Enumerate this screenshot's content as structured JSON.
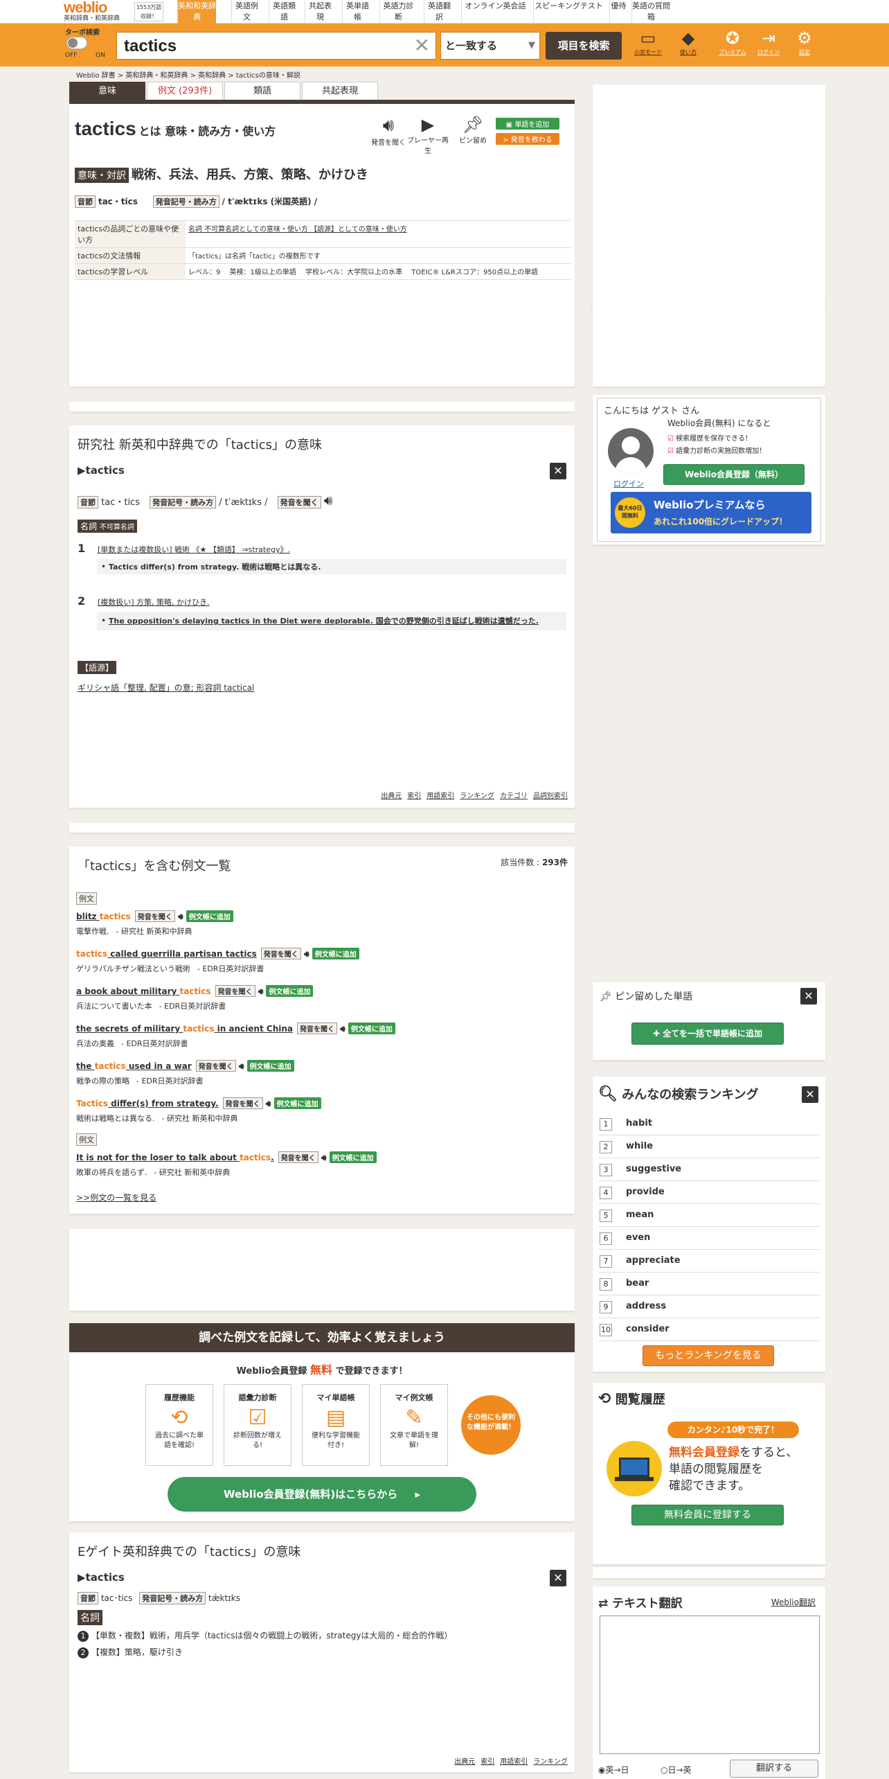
{
  "topnav": {
    "logo": "weblio",
    "logo_sub": "英和辞典・和英辞典",
    "word_count": "1553万語収録！",
    "tabs": [
      "英和和英辞典",
      "英語例文",
      "英語類語",
      "共起表現",
      "英単語帳",
      "英語力診断",
      "英語翻訳",
      "オンライン英会話",
      "スピーキングテスト",
      "優待",
      "英語の質問箱"
    ]
  },
  "searchbar": {
    "turbo_label": "ターボ検索",
    "turbo_off": "OFF",
    "turbo_on": "ON",
    "query": "tactics",
    "match_mode": "と一致する",
    "search_button": "項目を検索",
    "icons": [
      {
        "icon": "monitor-icon",
        "label": "小窓モード"
      },
      {
        "icon": "beginner-icon",
        "label": "使い方"
      },
      {
        "icon": "premium-icon",
        "label": "プレミアム"
      },
      {
        "icon": "login-icon",
        "label": "ログイン"
      },
      {
        "icon": "gear-icon",
        "label": "設定"
      }
    ]
  },
  "breadcrumb": "Weblio 辞書 > 英和辞典・和英辞典 > 英和辞典 > tacticsの意味・解説",
  "main_tabs": [
    "意味",
    "例文 (293件)",
    "類語",
    "共起表現"
  ],
  "head": {
    "word": "tactics",
    "title_suffix": "とは 意味・読み方・使い方",
    "btn_listen": "発音を聞く",
    "btn_player": "プレーヤー再生",
    "btn_pin": "ピン留め",
    "btn_add": "単語を追加",
    "btn_learn": "> 発音を教わる",
    "meaning_tag": "意味・対訳",
    "meaning": "戦術、兵法、用兵、方策、策略、かけひき",
    "syllable_tag": "音節",
    "syllable": "tac・tics",
    "pron_tag": "発音記号・読み方",
    "pron": "/ tˈæktɪks (米国英語) /",
    "info": [
      {
        "h": "tacticsの品詞ごとの意味や使い方",
        "v": "名詞 不可算名詞としての意味・使い方  【語源】としての意味・使い方"
      },
      {
        "h": "tacticsの文法情報",
        "v": "「tactics」は名詞「tactic」の複数形です"
      },
      {
        "h": "tacticsの学習レベル",
        "v": "レベル：9　 英検：1級以上の単語　 学校レベル：大学院以上の水準　 TOEIC® L&Rスコア：950点以上の単語"
      }
    ]
  },
  "kenkyusha": {
    "title": "研究社 新英和中辞典での「tactics」の意味",
    "word": "▶tactics",
    "syllable_tag": "音節",
    "syllable": "tac・tics",
    "pron_tag": "発音記号・読み方",
    "pron": "/ tˈæktɪks /",
    "listen": "発音を聞く",
    "pos": "名詞",
    "pos_sub": "不可算名詞",
    "senses": [
      {
        "n": "1",
        "def": "[単数または複数扱い] 戦術 《★ 【類語】 ⇒strategy》.",
        "ex": "Tactics differ(s) from strategy. 戦術は戦略とは異なる."
      },
      {
        "n": "2",
        "def": "[複数扱い] 方策, 策略, かけひき.",
        "ex": "The opposition's delaying tactics in the Diet were deplorable. 国会での野党側の引き延ばし戦術は遺憾だった."
      }
    ],
    "etym_tag": "【語源】",
    "etym": "ギリシャ語「整理, 配置」の意; 形容詞 tactical",
    "footer": [
      "出典元",
      "索引",
      "用語索引",
      "ランキング",
      "カテゴリ",
      "品詞別索引"
    ]
  },
  "examples": {
    "title": "「tactics」を含む例文一覧",
    "count_label": "該当件数 :",
    "count": "293件",
    "section1": "例文",
    "section2": "例文",
    "listen": "発音を聞く",
    "add": "例文帳に追加",
    "items": [
      {
        "en_pre": "blitz ",
        "hl": "tactics",
        "en_post": "",
        "ja": "電撃作戦.",
        "src": "- 研究社 新英和中辞典"
      },
      {
        "en_pre": "",
        "hl": "tactics",
        "en_post": " called guerrilla partisan tactics",
        "ja": "ゲリラパルチザン戦法という戦術",
        "src": "- EDR日英対訳辞書"
      },
      {
        "en_pre": "a book about military ",
        "hl": "tactics",
        "en_post": "",
        "ja": "兵法について書いた本",
        "src": "- EDR日英対訳辞書"
      },
      {
        "en_pre": "the secrets of military ",
        "hl": "tactics",
        "en_post": " in ancient China",
        "ja": "兵法の奥義",
        "src": "- EDR日英対訳辞書"
      },
      {
        "en_pre": "the ",
        "hl": "tactics",
        "en_post": " used in a war",
        "ja": "戦争の際の策略",
        "src": "- EDR日英対訳辞書"
      },
      {
        "en_pre": "",
        "hl": "Tactics",
        "en_post": " differ(s) from strategy.",
        "ja": "戦術は戦略とは異なる.",
        "src": "- 研究社 新英和中辞典"
      }
    ],
    "item7": {
      "en_pre": "It is not for the loser to talk about ",
      "hl": "tactics",
      "en_post": ".",
      "ja": "敗軍の将兵を語らず.",
      "src": "- 研究社 新和英中辞典"
    },
    "more": ">>例文の一覧を見る"
  },
  "promo": {
    "header": "調べた例文を記録して、効率よく覚えましょう",
    "line_pre": "Weblio会員登録",
    "line_free": "無料",
    "line_post": "で登録できます！",
    "cards": [
      {
        "t": "履歴機能",
        "d": "過去に調べた単語を確認!",
        "icon": "history-icon"
      },
      {
        "t": "語彙力診断",
        "d": "診断回数が増える!",
        "icon": "clipboard-icon"
      },
      {
        "t": "マイ単語帳",
        "d": "便利な学習機能付き!",
        "icon": "stack-icon"
      },
      {
        "t": "マイ例文帳",
        "d": "文章で単語を理解!",
        "icon": "note-icon"
      }
    ],
    "badge": "その他にも便利な機能が満載！",
    "button": "Weblio会員登録(無料)はこちらから"
  },
  "egate": {
    "title": "Eゲイト英和辞典での「tactics」の意味",
    "word": "▶tactics",
    "syllable_tag": "音節",
    "syllable": "tac･tics",
    "pron_tag": "発音記号・読み方",
    "pron": "tǽktɪks",
    "pos": "名詞",
    "s1": "【単数・複数】戦術，用兵学（tacticsは個々の戦闘上の戦術，strategyは大局的・総合的作戦）",
    "s2": "【複数】策略，駆け引き",
    "footer": [
      "出典元",
      "索引",
      "用語索引",
      "ランキング"
    ]
  },
  "sidebar": {
    "greeting": "こんにちは ゲスト さん",
    "member_line": "Weblio会員(無料) になると",
    "check1": "検索履歴を保存できる！",
    "check2": "語彙力診断の実施回数増加！",
    "login": "ログイン",
    "register_btn": "Weblio会員登録（無料）",
    "premium_badge": "最大60日間無料",
    "premium_line1": "Weblioプレミアムなら",
    "premium_line2": "あれこれ100倍にグレードアップ！",
    "pinned_title": "ピン留めした単語",
    "pinned_btn": "✚ 全てを一括で単語帳に追加",
    "ranking_title": "みんなの検索ランキング",
    "ranking": [
      "habit",
      "while",
      "suggestive",
      "provide",
      "mean",
      "even",
      "appreciate",
      "bear",
      "address",
      "consider"
    ],
    "ranking_more": "もっとランキングを見る",
    "history_title": "閲覧履歴",
    "history_badge": "カンタン♪10秒で完了！",
    "history_line1a": "無料会員登録",
    "history_line1b": "をすると、",
    "history_line2": "単語の閲覧履歴を",
    "history_line3": "確認できます。",
    "history_btn": "無料会員に登録する",
    "translate_title": "テキスト翻訳",
    "translate_link": "Weblio翻訳",
    "radio1": "英→日",
    "radio2": "日→英",
    "translate_btn": "翻訳する"
  }
}
